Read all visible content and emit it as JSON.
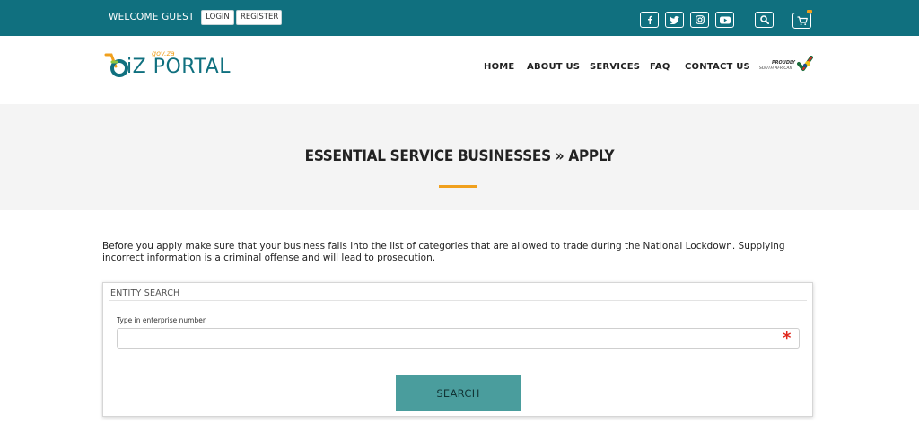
{
  "topbar": {
    "welcome": "WELCOME GUEST",
    "login_label": "LOGIN",
    "register_label": "REGISTER",
    "social_icons": [
      "facebook-icon",
      "twitter-icon",
      "instagram-icon",
      "youtube-icon"
    ],
    "color": "#10707f"
  },
  "logo": {
    "gov": "gov.za",
    "text": "iZ PORTAL"
  },
  "nav": {
    "items": [
      "HOME",
      "ABOUT US",
      "SERVICES",
      "FAQ",
      "CONTACT US"
    ]
  },
  "proudly": {
    "line1": "PROUDLY",
    "line2": "SOUTH AFRICAN"
  },
  "page": {
    "title": "ESSENTIAL SERVICE BUSINESSES » APPLY",
    "accent_color": "#f0a01d",
    "notice": "Before you apply make sure that your business falls into the list of categories that are allowed to trade during the National Lockdown. Supplying incorrect information is a criminal offense and will lead to prosecution."
  },
  "entity_search": {
    "title": "ENTITY SEARCH",
    "field_label": "Type in enterprise number",
    "field_value": "",
    "required_mark": "*",
    "search_label": "SEARCH",
    "button_color": "#4a9d9d"
  }
}
